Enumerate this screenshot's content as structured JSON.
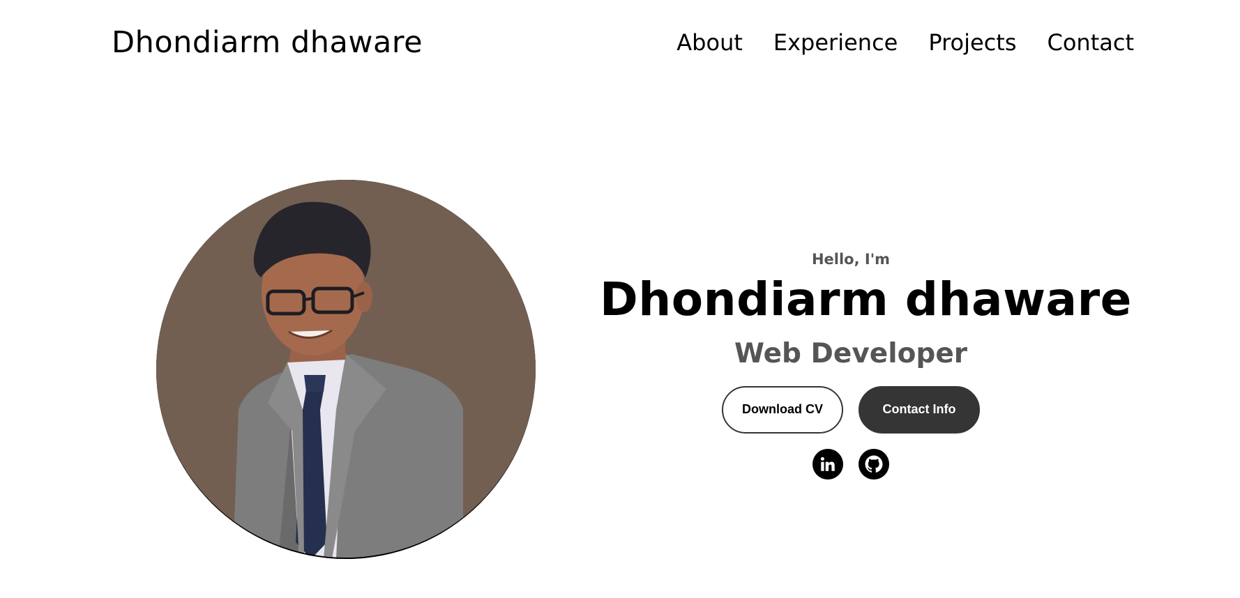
{
  "header": {
    "logo": "Dhondiarm dhaware",
    "nav": [
      {
        "label": "About"
      },
      {
        "label": "Experience"
      },
      {
        "label": "Projects"
      },
      {
        "label": "Contact"
      }
    ]
  },
  "hero": {
    "greeting": "Hello, I'm",
    "name": "Dhondiarm dhaware",
    "role": "Web Developer",
    "buttons": {
      "download_cv": "Download CV",
      "contact_info": "Contact Info"
    },
    "socials": [
      {
        "icon": "linkedin-icon"
      },
      {
        "icon": "github-icon"
      }
    ]
  },
  "colors": {
    "accent_dark": "#353535",
    "muted_text": "#555555",
    "photo_background": "#725f52"
  }
}
